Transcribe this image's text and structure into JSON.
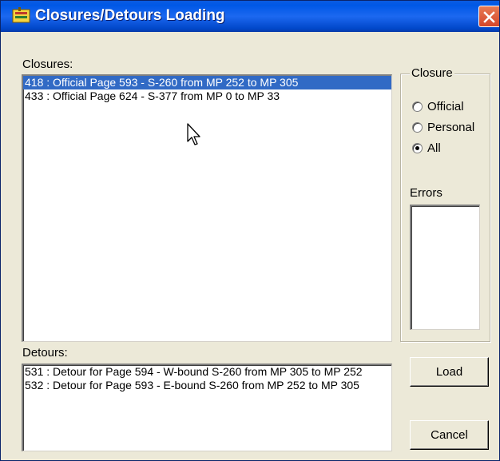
{
  "window": {
    "title": "Closures/Detours Loading",
    "icons": {
      "app": "closure-app-icon",
      "close": "close-icon"
    }
  },
  "closures": {
    "label": "Closures:",
    "items": [
      {
        "text": "418 : Official Page 593 - S-260 from MP 252 to MP 305",
        "selected": true
      },
      {
        "text": "433 : Official Page 624 - S-377 from MP 0 to MP 33",
        "selected": false
      }
    ]
  },
  "closure_filter": {
    "title": "Closure",
    "options": [
      {
        "label": "Official",
        "checked": false
      },
      {
        "label": "Personal",
        "checked": false
      },
      {
        "label": "All",
        "checked": true
      }
    ]
  },
  "errors": {
    "label": "Errors"
  },
  "detours": {
    "label": "Detours:",
    "items": [
      {
        "text": "531 : Detour for Page 594 - W-bound S-260 from MP 305 to MP 252"
      },
      {
        "text": "532 : Detour for Page 593 - E-bound S-260 from MP 252 to MP 305"
      }
    ]
  },
  "buttons": {
    "load": "Load",
    "cancel": "Cancel"
  },
  "colors": {
    "titlebar": "#0058e6",
    "selection": "#316ac5",
    "dialog_bg": "#ece9d8",
    "close": "#d4462a"
  }
}
